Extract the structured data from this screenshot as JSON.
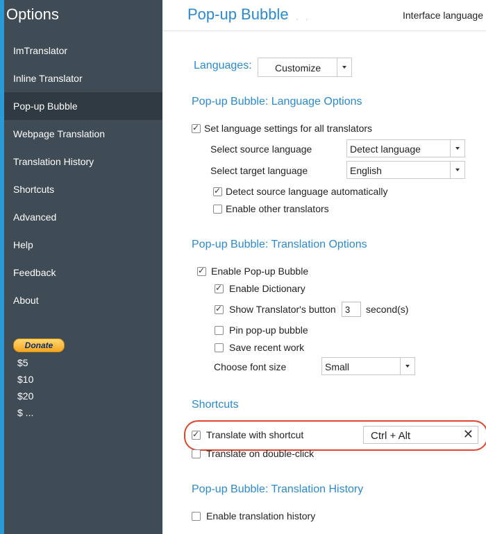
{
  "sidebar": {
    "title": "Options",
    "items": [
      {
        "label": "ImTranslator"
      },
      {
        "label": "Inline Translator"
      },
      {
        "label": "Pop-up Bubble"
      },
      {
        "label": "Webpage Translation"
      },
      {
        "label": "Translation History"
      },
      {
        "label": "Shortcuts"
      },
      {
        "label": "Advanced"
      },
      {
        "label": "Help"
      },
      {
        "label": "Feedback"
      },
      {
        "label": "About"
      }
    ],
    "donate_label": "Donate",
    "amounts": [
      "$5",
      "$10",
      "$20",
      "$ ..."
    ]
  },
  "header": {
    "title": "Pop-up Bubble",
    "interface_language_label": "Interface language"
  },
  "languages": {
    "label": "Languages:",
    "value": "Customize"
  },
  "language_options": {
    "heading": "Pop-up Bubble: Language Options",
    "set_all_label": "Set language settings for all translators",
    "source_label": "Select source language",
    "source_value": "Detect language",
    "target_label": "Select target language",
    "target_value": "English",
    "detect_auto_label": "Detect source language automatically",
    "enable_other_label": "Enable other translators"
  },
  "translation_options": {
    "heading": "Pop-up Bubble: Translation Options",
    "enable_bubble_label": "Enable Pop-up Bubble",
    "enable_dictionary_label": "Enable Dictionary",
    "show_button_label": "Show Translator's button",
    "show_button_seconds": "3",
    "seconds_label": "second(s)",
    "pin_label": "Pin pop-up bubble",
    "save_recent_label": "Save recent work",
    "font_size_label": "Choose font size",
    "font_size_value": "Small"
  },
  "shortcuts": {
    "heading": "Shortcuts",
    "translate_shortcut_label": "Translate with shortcut",
    "shortcut_value": "Ctrl + Alt",
    "double_click_label": "Translate on double-click"
  },
  "history": {
    "heading": "Pop-up Bubble: Translation History",
    "enable_history_label": "Enable translation history"
  },
  "checks": {
    "set_all": true,
    "detect_auto": true,
    "enable_other": false,
    "enable_bubble": true,
    "enable_dictionary": true,
    "show_button": true,
    "pin": false,
    "save_recent": false,
    "translate_shortcut": true,
    "double_click": false,
    "enable_history": false
  },
  "colors": {
    "accent": "#2a8ad0",
    "sidebar_bg": "#3f4b55",
    "highlight_ring": "#e0452c"
  }
}
